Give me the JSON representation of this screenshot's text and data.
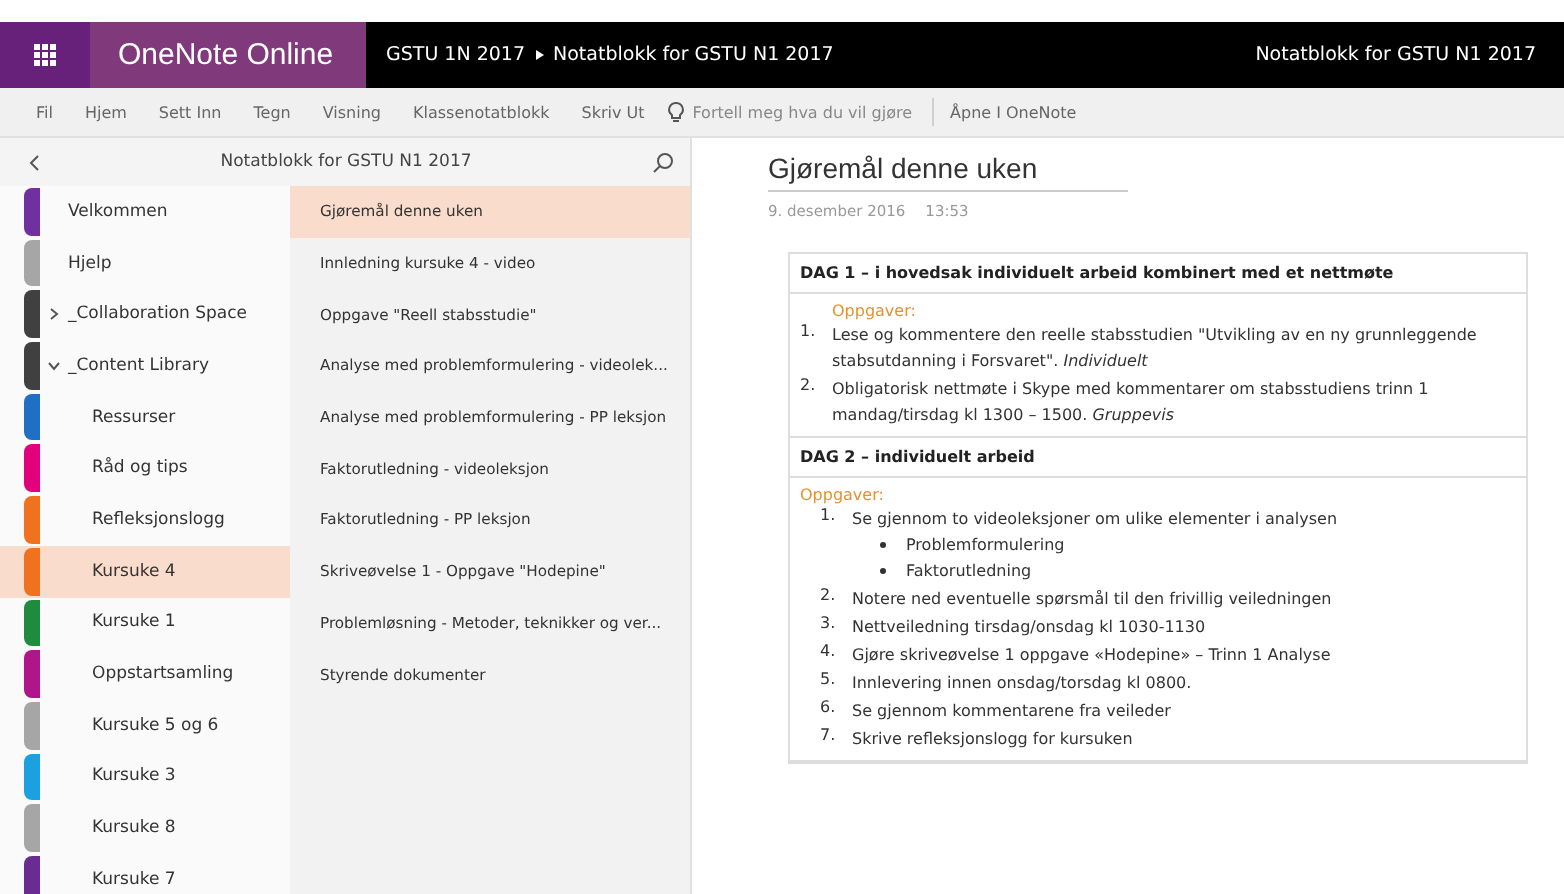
{
  "app_bar": {
    "app_name": "OneNote Online",
    "breadcrumb": [
      "GSTU 1N 2017",
      "Notatblokk for GSTU N1 2017"
    ],
    "notebook_title": "Notatblokk for GSTU N1 2017"
  },
  "ribbon": {
    "tabs": [
      "Fil",
      "Hjem",
      "Sett Inn",
      "Tegn",
      "Visning",
      "Klassenotatblokk",
      "Skriv Ut"
    ],
    "tell_me": {
      "placeholder": "Fortell meg hva du vil gjøre"
    },
    "open_in_app": "Åpne I OneNote"
  },
  "navigation": {
    "title": "Notatblokk for GSTU N1 2017",
    "sections": [
      {
        "kind": "section",
        "name": "Velkommen",
        "color": "#7030a0",
        "selected": false
      },
      {
        "kind": "section",
        "name": "Hjelp",
        "color": "#a6a6a6",
        "selected": false
      },
      {
        "kind": "group",
        "name": "_Collaboration Space",
        "color": "#404040",
        "expanded": false
      },
      {
        "kind": "group",
        "name": "_Content Library",
        "color": "#404040",
        "expanded": true,
        "children": [
          {
            "kind": "section",
            "name": "Ressurser",
            "color": "#1f6fc5",
            "selected": false
          },
          {
            "kind": "section",
            "name": "Råd og tips",
            "color": "#e3007d",
            "selected": false
          },
          {
            "kind": "section",
            "name": "Refleksjonslogg",
            "color": "#f0721e",
            "selected": false
          },
          {
            "kind": "section",
            "name": "Kursuke 4",
            "color": "#f0721e",
            "selected": true
          },
          {
            "kind": "section",
            "name": "Kursuke 1",
            "color": "#1e8c3c",
            "selected": false
          },
          {
            "kind": "section",
            "name": "Oppstartsamling",
            "color": "#b0158c",
            "selected": false
          },
          {
            "kind": "section",
            "name": "Kursuke 5 og 6",
            "color": "#a6a6a6",
            "selected": false
          },
          {
            "kind": "section",
            "name": "Kursuke 3",
            "color": "#1ba1e2",
            "selected": false
          },
          {
            "kind": "section",
            "name": "Kursuke 8",
            "color": "#a6a6a6",
            "selected": false
          },
          {
            "kind": "section",
            "name": "Kursuke 7",
            "color": "#6a2c91",
            "selected": false
          }
        ]
      }
    ],
    "pages": [
      {
        "title": "Gjøremål denne uken",
        "selected": true
      },
      {
        "title": "Innledning kursuke 4 - video",
        "selected": false
      },
      {
        "title": "Oppgave \"Reell stabsstudie\"",
        "selected": false
      },
      {
        "title": "Analyse med problemformulering - videolek...",
        "selected": false
      },
      {
        "title": "Analyse med problemformulering - PP leksjon",
        "selected": false
      },
      {
        "title": "Faktorutledning - videoleksjon",
        "selected": false
      },
      {
        "title": "Faktorutledning - PP leksjon",
        "selected": false
      },
      {
        "title": "Skriveøvelse 1 - Oppgave \"Hodepine\"",
        "selected": false
      },
      {
        "title": "Problemløsning - Metoder, teknikker og ver...",
        "selected": false
      },
      {
        "title": "Styrende dokumenter",
        "selected": false
      }
    ]
  },
  "page": {
    "title": "Gjøremål denne uken",
    "date": "9. desember 2016",
    "time": "13:53",
    "table": [
      {
        "heading": "DAG 1 – i hovedsak individuelt arbeid kombinert med et nettmøte",
        "label": "Oppgaver:",
        "indent_label": true,
        "items": [
          {
            "number": "1.",
            "text": "Lese og kommentere den reelle stabsstudien \"Utvikling av en ny grunnleggende stabsutdanning i Forsvaret\". *Individuelt*"
          },
          {
            "number": "2.",
            "text": "Obligatorisk nettmøte i Skype med kommentarer om stabsstudiens trinn 1 mandag/tirsdag kl 1300 – 1500. *Gruppevis*"
          }
        ]
      },
      {
        "heading": "DAG 2 – individuelt arbeid",
        "label": "Oppgaver:",
        "indent_label": false,
        "items": [
          {
            "number": "1.",
            "text": "Se gjennom to videoleksjoner om ulike elementer i analysen",
            "bullets": [
              "Problemformulering",
              "Faktorutledning"
            ]
          },
          {
            "number": "2.",
            "text": "Notere ned eventuelle spørsmål til den frivillig veiledningen"
          },
          {
            "number": "3.",
            "text": "Nettveiledning tirsdag/onsdag kl 1030-1130"
          },
          {
            "number": "4.",
            "text": "Gjøre skriveøvelse 1 oppgave «Hodepine» – Trinn 1 Analyse"
          },
          {
            "number": "5.",
            "text": "Innlevering innen onsdag/torsdag kl 0800."
          },
          {
            "number": "6.",
            "text": "Se gjennom kommentarene fra veileder"
          },
          {
            "number": "7.",
            "text": "Skrive refleksjonslogg for kursuken"
          }
        ]
      }
    ]
  }
}
